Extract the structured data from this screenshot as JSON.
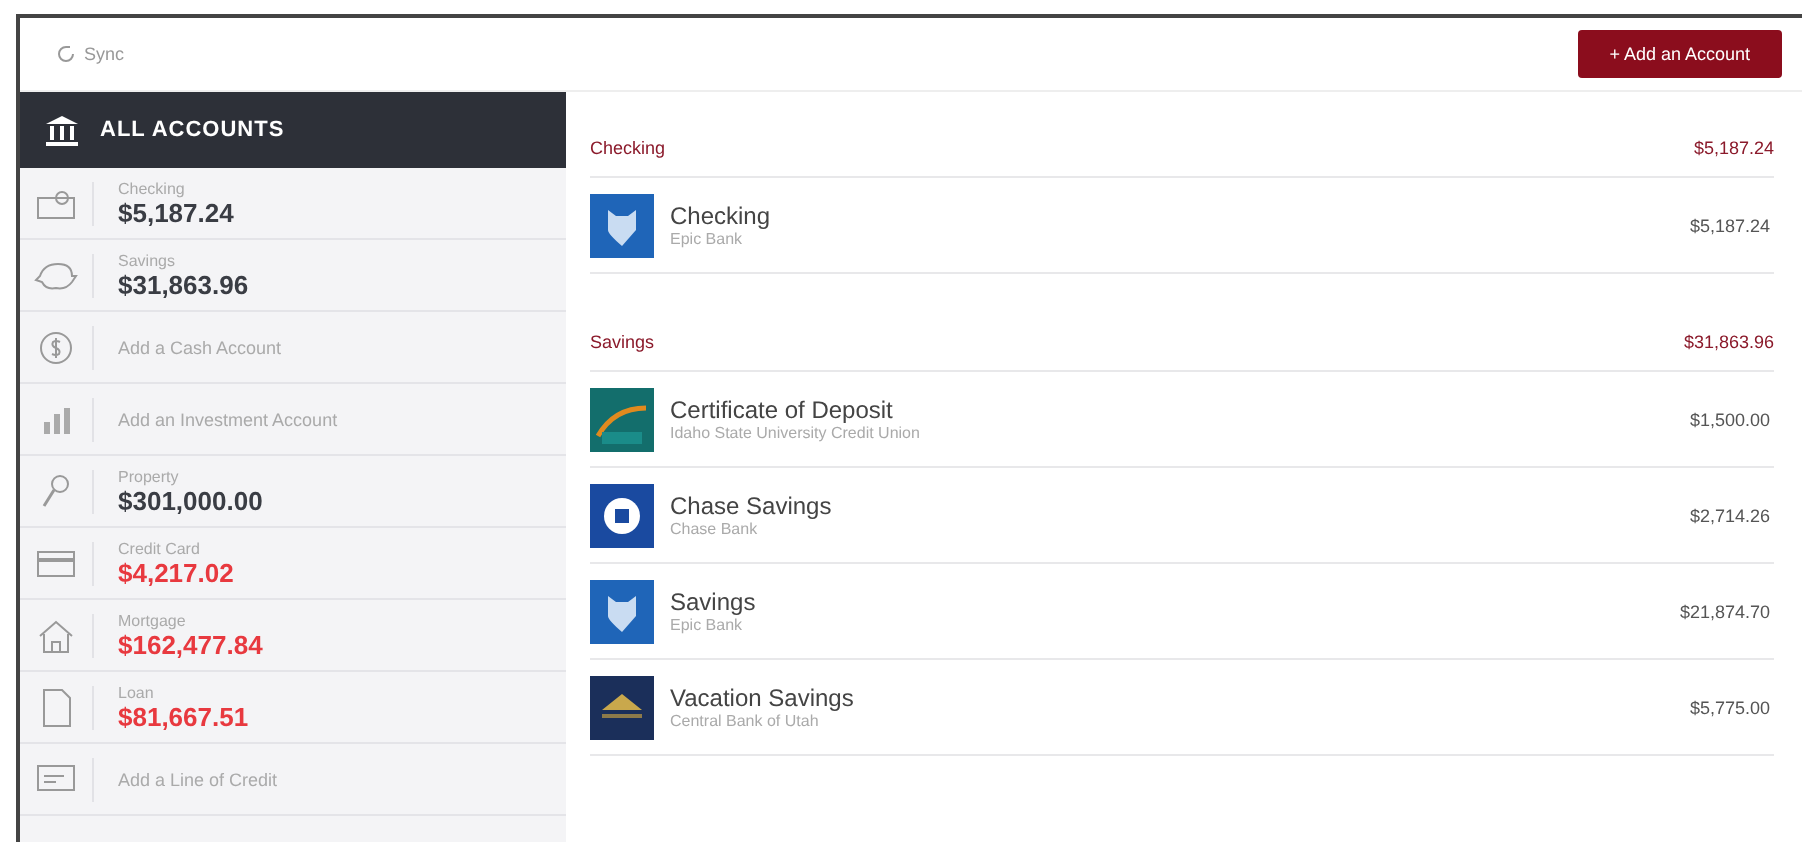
{
  "toolbar": {
    "sync": "Sync",
    "add_button": "+ Add an Account"
  },
  "sidebar": {
    "header": "ALL ACCOUNTS",
    "items": [
      {
        "kind": "asset",
        "label": "Checking",
        "amount": "$5,187.24"
      },
      {
        "kind": "asset",
        "label": "Savings",
        "amount": "$31,863.96"
      },
      {
        "kind": "add",
        "label": "Add a Cash Account"
      },
      {
        "kind": "add",
        "label": "Add an Investment Account"
      },
      {
        "kind": "asset",
        "label": "Property",
        "amount": "$301,000.00"
      },
      {
        "kind": "debt",
        "label": "Credit Card",
        "amount": "$4,217.02"
      },
      {
        "kind": "debt",
        "label": "Mortgage",
        "amount": "$162,477.84"
      },
      {
        "kind": "debt",
        "label": "Loan",
        "amount": "$81,667.51"
      },
      {
        "kind": "add",
        "label": "Add a Line of Credit"
      }
    ]
  },
  "sections": [
    {
      "title": "Checking",
      "total": "$5,187.24",
      "accounts": [
        {
          "name": "Checking",
          "bank": "Epic Bank",
          "amount": "$5,187.24",
          "kind": "shield"
        }
      ]
    },
    {
      "title": "Savings",
      "total": "$31,863.96",
      "accounts": [
        {
          "name": "Certificate of Deposit",
          "bank": "Idaho State University Credit Union",
          "amount": "$1,500.00",
          "kind": "swoosh"
        },
        {
          "name": "Chase Savings",
          "bank": "Chase Bank",
          "amount": "$2,714.26",
          "kind": "octagon"
        },
        {
          "name": "Savings",
          "bank": "Epic Bank",
          "amount": "$21,874.70",
          "kind": "shield"
        },
        {
          "name": "Vacation Savings",
          "bank": "Central Bank of Utah",
          "amount": "$5,775.00",
          "kind": "roof"
        }
      ]
    }
  ]
}
